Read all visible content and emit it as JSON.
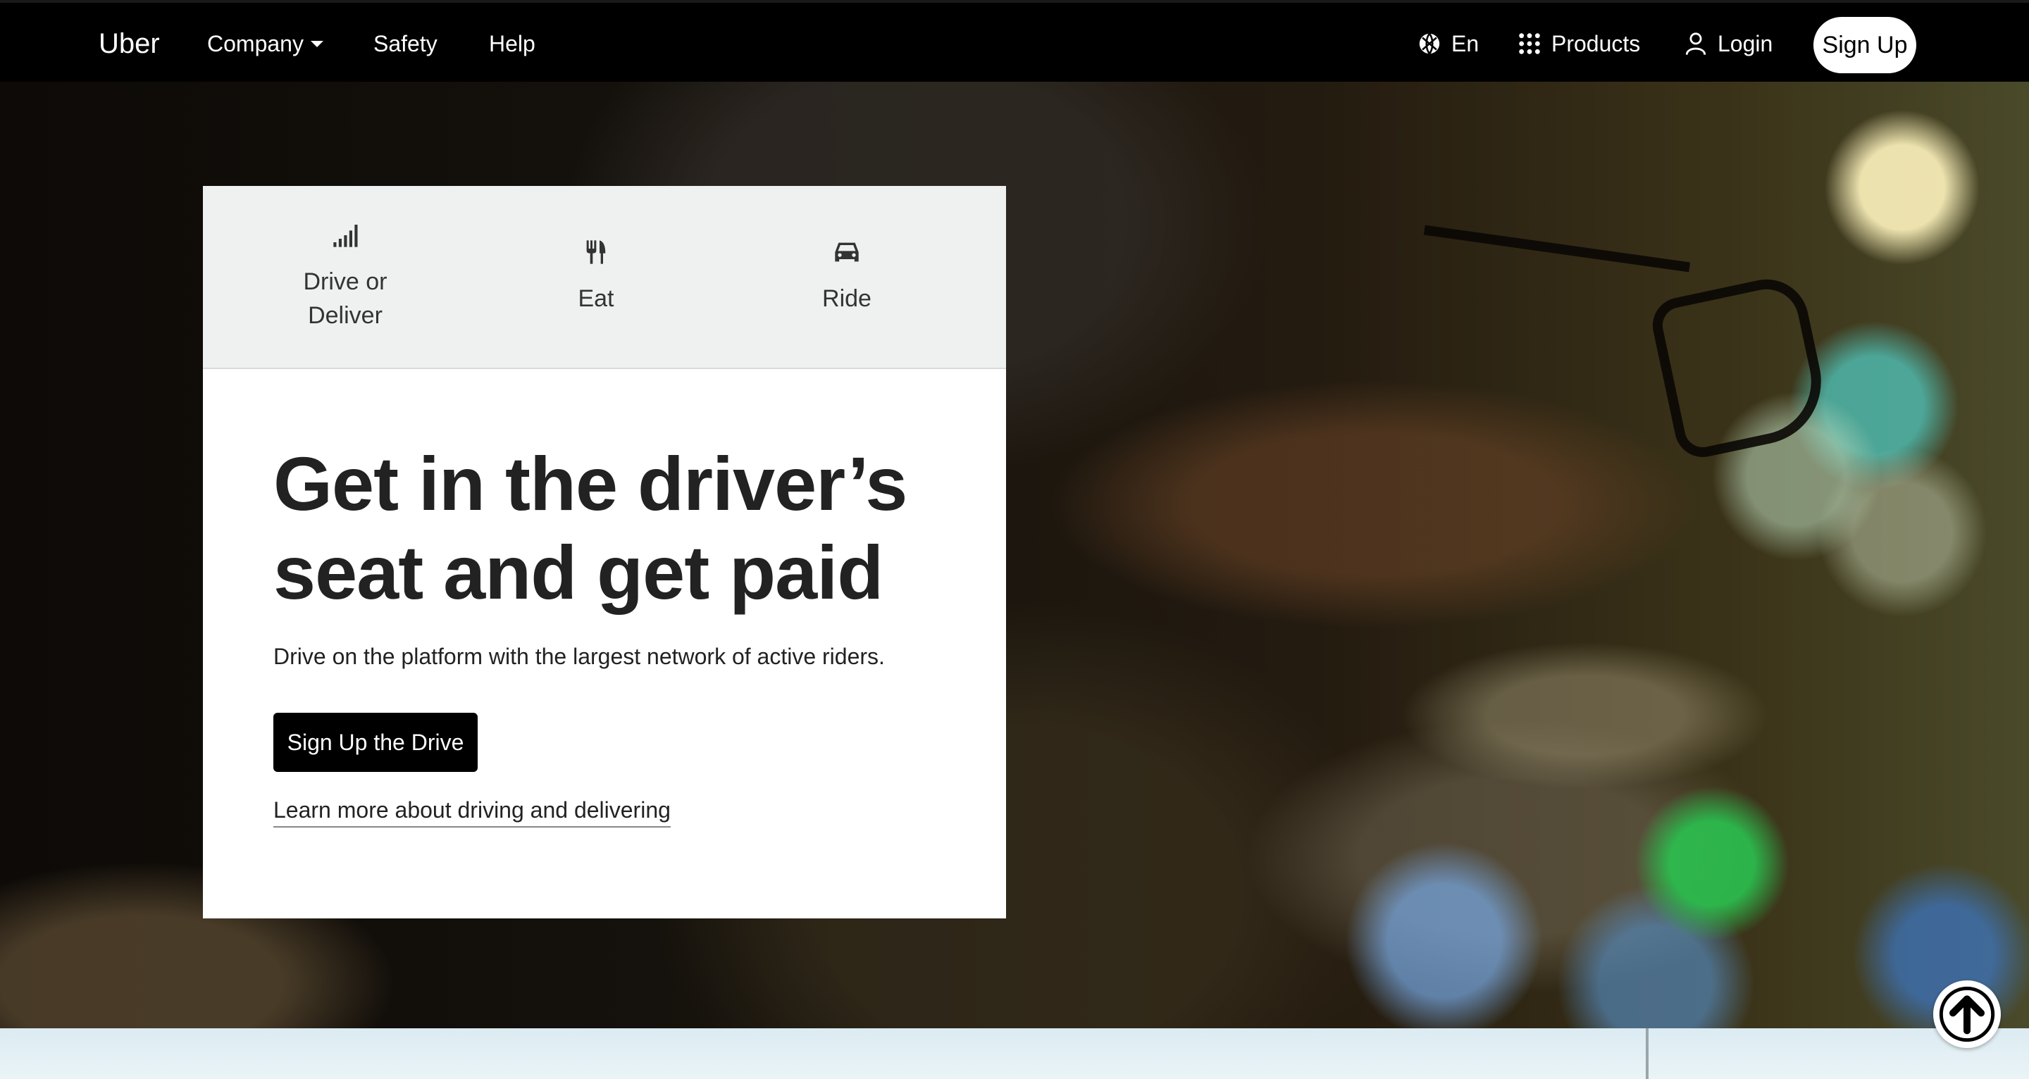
{
  "navbar": {
    "brand": "Uber",
    "links": {
      "company": "Company",
      "safety": "Safety",
      "help": "Help"
    },
    "language": "En",
    "products": "Products",
    "login": "Login",
    "signup": "Sign Up"
  },
  "card": {
    "tabs": {
      "drive": "Drive or Deliver",
      "eat": "Eat",
      "ride": "Ride"
    },
    "title": "Get in the driver’s seat and get paid",
    "description": "Drive on the platform with the largest network of active riders.",
    "cta": "Sign Up the Drive",
    "learn_more": "Learn more about driving and delivering"
  },
  "icons": {
    "language": "globe-icon",
    "products": "grid-icon",
    "login": "user-icon",
    "drive": "signal-bars-icon",
    "eat": "utensils-icon",
    "ride": "car-icon",
    "scroll_top": "arrow-up-icon"
  },
  "colors": {
    "navbar_bg": "#000000",
    "tabs_bg": "#eff1f0",
    "cta_bg": "#000000",
    "text": "#222222"
  }
}
